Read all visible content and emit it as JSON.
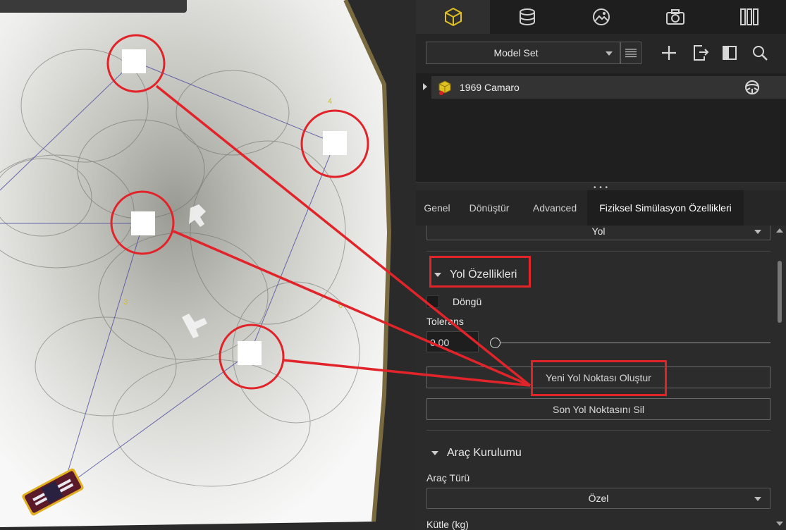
{
  "toolbar": {
    "model_set_label": "Model Set"
  },
  "tree": {
    "item_label": "1969 Camaro"
  },
  "tabs": [
    {
      "label": "Genel"
    },
    {
      "label": "Dönüştür"
    },
    {
      "label": "Advanced"
    },
    {
      "label": "Fiziksel Simülasyon Özellikleri"
    }
  ],
  "props": {
    "type_value": "Yol",
    "road_section": "Yol Özellikleri",
    "loop_label": "Döngü",
    "tolerance_label": "Tolerans",
    "tolerance_value": "0.00",
    "create_point_button": "Yeni Yol Noktası Oluştur",
    "delete_point_button": "Son Yol Noktasını Sil",
    "vehicle_section": "Araç Kurulumu",
    "vehicle_type_label": "Araç Türü",
    "vehicle_type_value": "Özel",
    "mass_label": "Kütle (kg)"
  },
  "viewport": {
    "waypoint_numbers": [
      "4",
      "3",
      "6"
    ]
  },
  "colors": {
    "highlight_red": "#e0242a",
    "active_icon_yellow": "#e0c020",
    "panel_bg": "#2b2b2b"
  }
}
